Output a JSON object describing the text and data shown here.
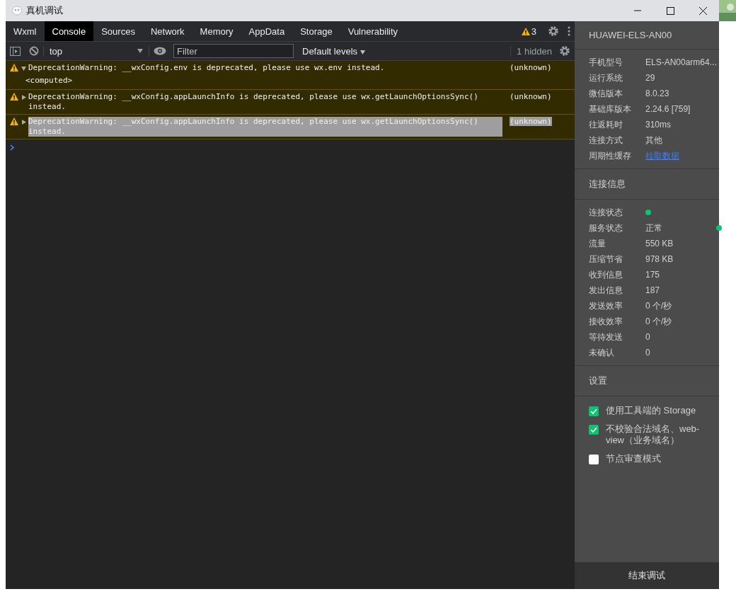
{
  "window": {
    "title": "真机调试"
  },
  "tabs": [
    {
      "label": "Wxml",
      "selected": false
    },
    {
      "label": "Console",
      "selected": true
    },
    {
      "label": "Sources",
      "selected": false
    },
    {
      "label": "Network",
      "selected": false
    },
    {
      "label": "Memory",
      "selected": false
    },
    {
      "label": "AppData",
      "selected": false
    },
    {
      "label": "Storage",
      "selected": false
    },
    {
      "label": "Vulnerability",
      "selected": false
    }
  ],
  "warning_count": "3",
  "toolbar": {
    "context": "top",
    "filter_placeholder": "Filter",
    "levels": "Default levels",
    "hidden": "1 hidden"
  },
  "messages": [
    {
      "text": "DeprecationWarning: __wxConfig.env is deprecated, please use wx.env instead.",
      "source": "(unknown)",
      "expanded": true,
      "detail": "<computed>",
      "selected": false
    },
    {
      "text": "DeprecationWarning: __wxConfig.appLaunchInfo is deprecated, please use wx.getLaunchOptionsSync() instead.",
      "source": "(unknown)",
      "expanded": false,
      "selected": false
    },
    {
      "text": "DeprecationWarning: __wxConfig.appLaunchInfo is deprecated, please use wx.getLaunchOptionsSync() instead.",
      "source": "(unknown)",
      "expanded": false,
      "selected": true
    }
  ],
  "device": {
    "name": "HUAWEI-ELS-AN00",
    "info": [
      {
        "label": "手机型号",
        "value": "ELS-AN00arm64...",
        "kind": "text"
      },
      {
        "label": "运行系统",
        "value": "29",
        "kind": "text"
      },
      {
        "label": "微信版本",
        "value": "8.0.23",
        "kind": "text"
      },
      {
        "label": "基础库版本",
        "value": "2.24.6 [759]",
        "kind": "text"
      },
      {
        "label": "往返耗时",
        "value": "310ms",
        "kind": "text"
      },
      {
        "label": "连接方式",
        "value": "其他",
        "kind": "text"
      },
      {
        "label": "周期性缓存",
        "value": "拉取数据",
        "kind": "link"
      }
    ]
  },
  "connection": {
    "title": "连接信息",
    "items": [
      {
        "label": "连接状态",
        "color": "#0bc46f"
      },
      {
        "label": "服务状态",
        "value": "正常",
        "color": "#0bc46f"
      },
      {
        "label": "流量",
        "value": "550 KB"
      },
      {
        "label": "压缩节省",
        "value": "978 KB"
      },
      {
        "label": "收到信息",
        "value": "175"
      },
      {
        "label": "发出信息",
        "value": "187"
      },
      {
        "label": "发送效率",
        "value": "0 个/秒"
      },
      {
        "label": "接收效率",
        "value": "0 个/秒"
      },
      {
        "label": "等待发送",
        "value": "0"
      },
      {
        "label": "未确认",
        "value": "0"
      }
    ]
  },
  "settings": {
    "title": "设置",
    "options": [
      {
        "label": "使用工具端的 Storage",
        "checked": true
      },
      {
        "label": "不校验合法域名、web-view（业务域名）",
        "checked": true
      },
      {
        "label": "节点审查模式",
        "checked": false
      }
    ]
  },
  "end_button": "结束调试"
}
